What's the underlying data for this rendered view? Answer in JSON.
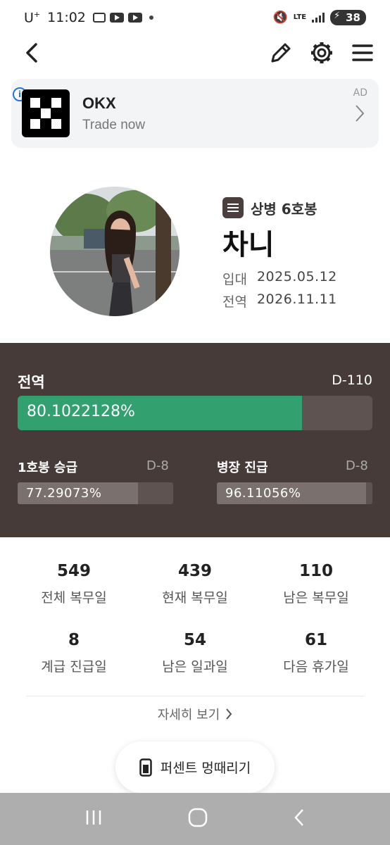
{
  "status_bar": {
    "carrier": "U",
    "carrier_sup": "+",
    "time": "11:02",
    "network": "LTE",
    "battery": "38"
  },
  "header": {
    "icons": [
      "back-arrow-icon",
      "pencil-icon",
      "gear-icon",
      "menu-icon"
    ]
  },
  "ad": {
    "info": "i",
    "title": "OKX",
    "subtitle": "Trade now",
    "label": "AD"
  },
  "profile": {
    "rank": "상병 6호봉",
    "name": "차니",
    "enlist_label": "입대",
    "enlist_date": "2025.05.12",
    "discharge_label": "전역",
    "discharge_date": "2026.11.11"
  },
  "progress": {
    "main": {
      "label": "전역",
      "dday": "D-110",
      "percent_text": "80.1022128%",
      "percent": 80.1022128
    },
    "promotion": {
      "label": "1호봉 승급",
      "dday": "D-8",
      "percent_text": "77.29073%",
      "percent": 77.29073
    },
    "rank_up": {
      "label": "병장 진급",
      "dday": "D-8",
      "percent_text": "96.11056%",
      "percent": 96.11056
    }
  },
  "stats": [
    {
      "value": "549",
      "label": "전체 복무일"
    },
    {
      "value": "439",
      "label": "현재 복무일"
    },
    {
      "value": "110",
      "label": "남은 복무일"
    },
    {
      "value": "8",
      "label": "계급 진급일"
    },
    {
      "value": "54",
      "label": "남은 일과일"
    },
    {
      "value": "61",
      "label": "다음 휴가일"
    }
  ],
  "detail_link": "자세히 보기",
  "fab_label": "퍼센트 멍때리기",
  "colors": {
    "panel_bg": "#463b38",
    "progress_green": "#33a06f",
    "bar_track": "#5e5350"
  }
}
